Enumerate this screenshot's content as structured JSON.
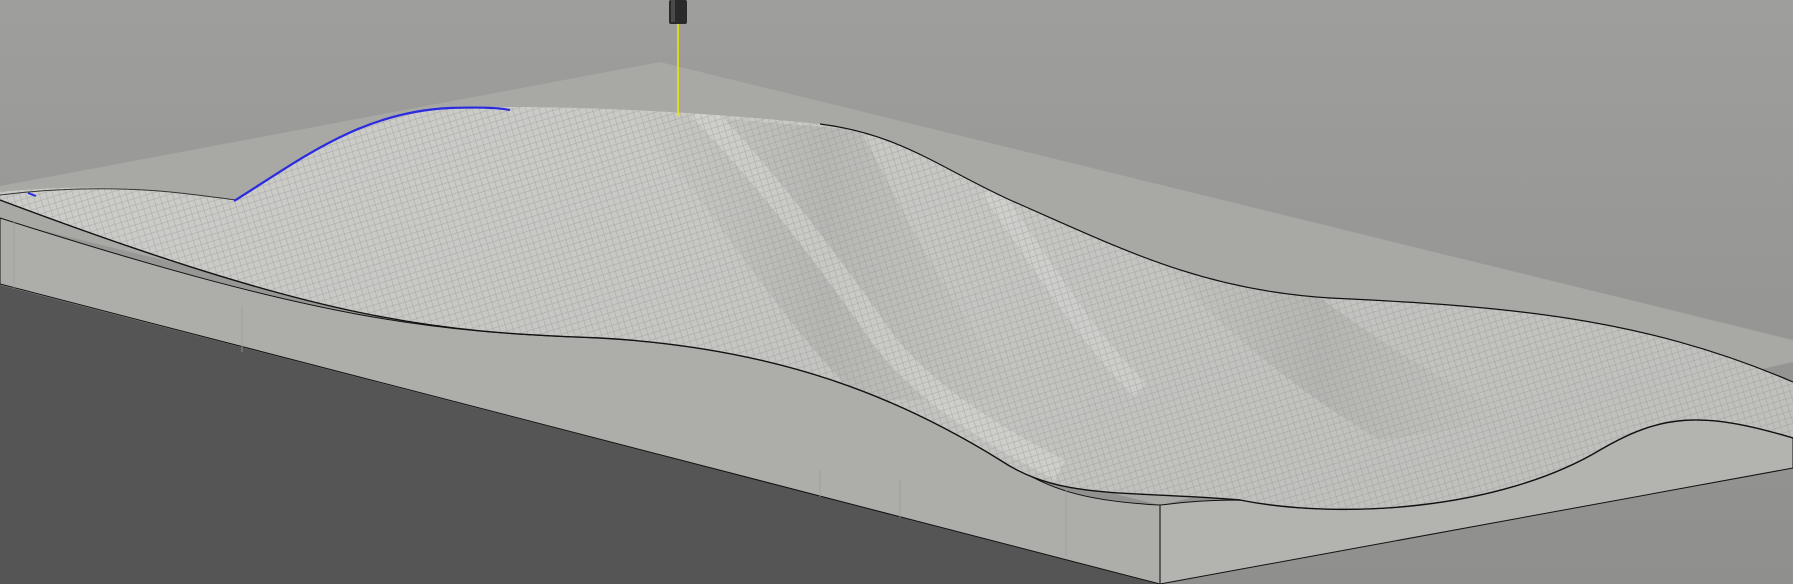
{
  "viewport": {
    "kind": "cam-3d-toolpath-simulation",
    "background_top": "#9e9e9c",
    "background_bottom": "#8f8f8d",
    "floor_color": "#555555"
  },
  "stock": {
    "surface_color": "#c6c6c3",
    "side_color": "#adadaa",
    "edge_color": "#111111",
    "texture": "crosshatch-tool-marks"
  },
  "tool": {
    "name": "end-mill",
    "body_color": "#2a2a2a",
    "axis_color": "#e8e800"
  },
  "toolpath": {
    "color": "#2a2ae0"
  }
}
